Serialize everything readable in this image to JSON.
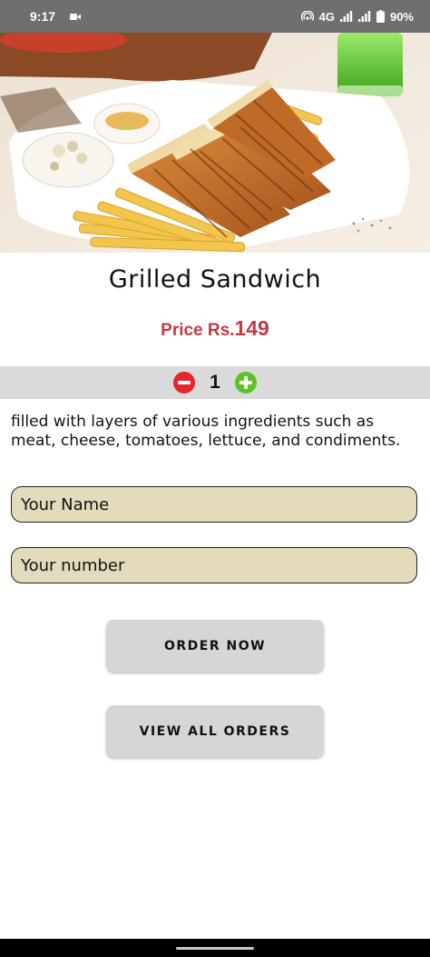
{
  "status_bar": {
    "time": "9:17",
    "network": "4G",
    "battery": "90%",
    "icons": [
      "video-record-icon",
      "hotspot-icon",
      "signal-icon",
      "signal-icon",
      "battery-icon"
    ]
  },
  "product": {
    "image_alt": "grilled-sandwich-with-fries-image",
    "title": "Grilled Sandwich",
    "price_label": "Price Rs.",
    "price_value": "149",
    "description": "filled with layers of various ingredients such as meat, cheese, tomatoes, lettuce, and condiments."
  },
  "quantity": {
    "value": "1",
    "minus_icon": "minus-circle-icon",
    "plus_icon": "plus-circle-icon"
  },
  "form": {
    "name_placeholder": "Your Name",
    "name_value": "",
    "number_placeholder": "Your number",
    "number_value": ""
  },
  "buttons": {
    "order_label": "ORDER NOW",
    "view_label": "VIEW ALL ORDERS"
  },
  "colors": {
    "price": "#c33a46",
    "field_bg": "#e2dcbc",
    "minus": "#e5272d",
    "plus": "#5cc326"
  }
}
